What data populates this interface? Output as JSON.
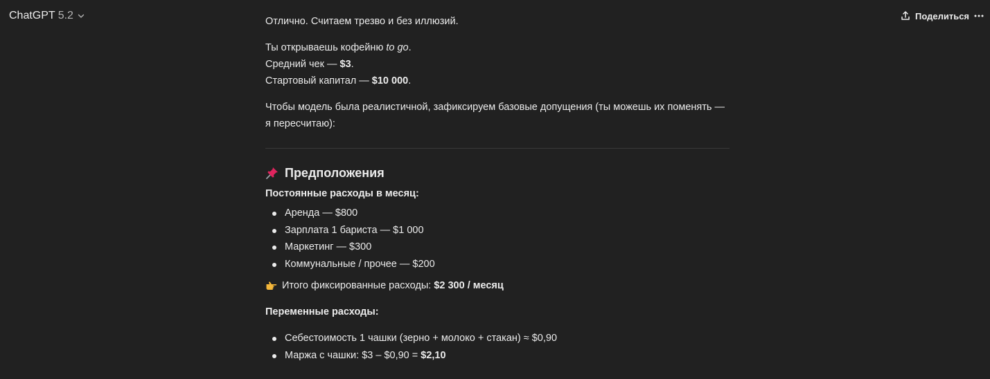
{
  "header": {
    "model_name": "ChatGPT",
    "model_version": "5.2",
    "share_label": "Поделиться"
  },
  "message": {
    "intro": "Отлично. Считаем трезво и без иллюзий.",
    "line1_prefix": "Ты открываешь кофейню ",
    "line1_em": "to go",
    "line1_suffix": ".",
    "line2_prefix": "Средний чек — ",
    "line2_bold": "$3",
    "line2_suffix": ".",
    "line3_prefix": "Стартовый капитал — ",
    "line3_bold": "$10 000",
    "line3_suffix": ".",
    "assumptions_intro": "Чтобы модель была реалистичной, зафиксируем базовые допущения (ты можешь их поменять — я пересчитаю):",
    "section_title": "Предположения",
    "fixed_heading": "Постоянные расходы в месяц:",
    "fixed_items": [
      "Аренда — $800",
      "Зарплата 1 бариста — $1 000",
      "Маркетинг — $300",
      "Коммунальные / прочее — $200"
    ],
    "total_prefix": "Итого фиксированные расходы: ",
    "total_bold": "$2 300 / месяц",
    "variable_heading": "Переменные расходы:",
    "variable_item1": "Себестоимость 1 чашки (зерно + молоко + стакан) ≈ $0,90",
    "variable_item2_prefix": "Маржа с чашки: $3 – $0,90 = ",
    "variable_item2_bold": "$2,10"
  },
  "colors": {
    "background": "#212121",
    "text": "#ececec",
    "muted": "#b4b4b4",
    "divider": "#3a3a3a",
    "pin": "#e0245e",
    "hand": "#f4b73a"
  },
  "icons": {
    "chevron": "chevron-down-icon",
    "share": "share-upload-icon",
    "more": "more-horizontal-icon",
    "pin": "pushpin-icon",
    "pointing": "pointing-right-icon"
  }
}
